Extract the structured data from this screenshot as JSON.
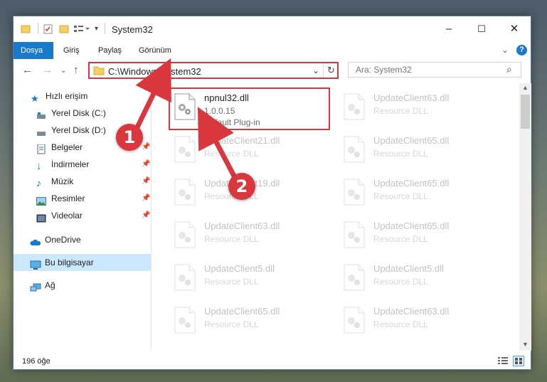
{
  "window": {
    "title": "System32",
    "controls": {
      "minimize": "–",
      "maximize": "☐",
      "close": "✕"
    }
  },
  "ribbon": {
    "tabs": [
      {
        "label": "Dosya",
        "active": true
      },
      {
        "label": "Giriş",
        "active": false
      },
      {
        "label": "Paylaş",
        "active": false
      },
      {
        "label": "Görünüm",
        "active": false
      }
    ],
    "help": "?",
    "collapse": "⌄"
  },
  "navigation": {
    "back": "←",
    "forward": "→",
    "recent": "⌄",
    "up": "↑",
    "address": "C:\\Windows\\System32",
    "address_dropdown": "⌄",
    "refresh": "↻",
    "search_placeholder": "Ara: System32",
    "search_icon": "⌕"
  },
  "sidebar": {
    "items": [
      {
        "label": "Hızlı erişim",
        "icon": "star-icon",
        "pinned": false
      },
      {
        "label": "Yerel Disk (C:)",
        "icon": "drive-icon",
        "pinned": false
      },
      {
        "label": "Yerel Disk (D:)",
        "icon": "drive-icon",
        "pinned": false
      },
      {
        "label": "Belgeler",
        "icon": "document-icon",
        "pinned": true
      },
      {
        "label": "İndirmeler",
        "icon": "download-icon",
        "pinned": true
      },
      {
        "label": "Müzik",
        "icon": "music-icon",
        "pinned": true
      },
      {
        "label": "Resimler",
        "icon": "picture-icon",
        "pinned": true
      },
      {
        "label": "Videolar",
        "icon": "video-icon",
        "pinned": true
      },
      {
        "label": "OneDrive",
        "icon": "cloud-icon",
        "pinned": false
      },
      {
        "label": "Bu bilgisayar",
        "icon": "computer-icon",
        "pinned": false,
        "selected": true
      },
      {
        "label": "Ağ",
        "icon": "network-icon",
        "pinned": false
      }
    ],
    "pin_glyph": "📌"
  },
  "files": {
    "highlighted": {
      "name": "npnul32.dll",
      "version": "1.0.0.15",
      "description": "Default Plug-in"
    },
    "column_left": [
      {
        "name": "UpdateClient21.dll",
        "type": "Resource DLL"
      },
      {
        "name": "UpdateClient19.dll",
        "type": "Resource DLL"
      },
      {
        "name": "UpdateClient63.dll",
        "type": "Resource DLL"
      },
      {
        "name": "UpdateClient5.dll",
        "type": "Resource DLL"
      },
      {
        "name": "UpdateClient65.dll",
        "type": "Resource DLL"
      }
    ],
    "column_right": [
      {
        "name": "UpdateClient63.dll",
        "type": "Resource DLL"
      },
      {
        "name": "UpdateClient65.dll",
        "type": "Resource DLL"
      },
      {
        "name": "UpdateClient65.dll",
        "type": "Resource DLL"
      },
      {
        "name": "UpdateClient65.dll",
        "type": "Resource DLL"
      },
      {
        "name": "UpdateClient5.dll",
        "type": "Resource DLL"
      },
      {
        "name": "UpdateClient63.dll",
        "type": "Resource DLL"
      }
    ]
  },
  "status": {
    "count": "196 öğe"
  },
  "annotations": {
    "step1": "1",
    "step2": "2",
    "color": "#d9363e"
  },
  "colors": {
    "accent": "#1979ca",
    "highlight": "#d9363e",
    "selection": "#cce8ff"
  }
}
